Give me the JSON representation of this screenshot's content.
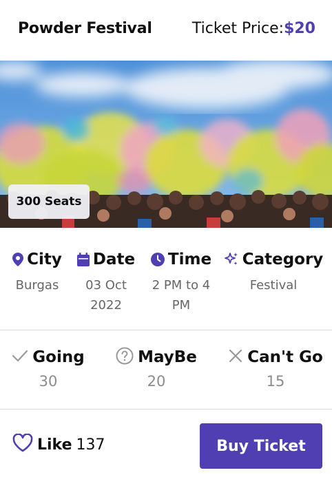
{
  "header": {
    "title": "Powder Festival",
    "price_label": "Ticket Price:",
    "price_value": "$20"
  },
  "hero": {
    "image_description_icon": "festival-photo",
    "seats_badge": "300 Seats"
  },
  "info": {
    "city": {
      "label": "City",
      "value": "Burgas",
      "icon": "location-pin-icon"
    },
    "date": {
      "label": "Date",
      "value": "03 Oct 2022",
      "icon": "calendar-icon"
    },
    "time": {
      "label": "Time",
      "value": "2 PM to 4 PM",
      "icon": "clock-icon"
    },
    "category": {
      "label": "Category",
      "value": "Festival",
      "icon": "sparkles-icon"
    }
  },
  "rsvp": {
    "going": {
      "label": "Going",
      "count": "30",
      "icon": "check-icon"
    },
    "maybe": {
      "label": "MayBe",
      "count": "20",
      "icon": "question-circle-icon"
    },
    "cant_go": {
      "label": "Can't Go",
      "count": "15",
      "icon": "x-icon"
    }
  },
  "footer": {
    "like_label": "Like",
    "like_count": "137",
    "buy_label": "Buy Ticket"
  },
  "colors": {
    "accent": "#4f3fb3",
    "muted_text": "#666666",
    "divider": "#d8d8d8"
  }
}
